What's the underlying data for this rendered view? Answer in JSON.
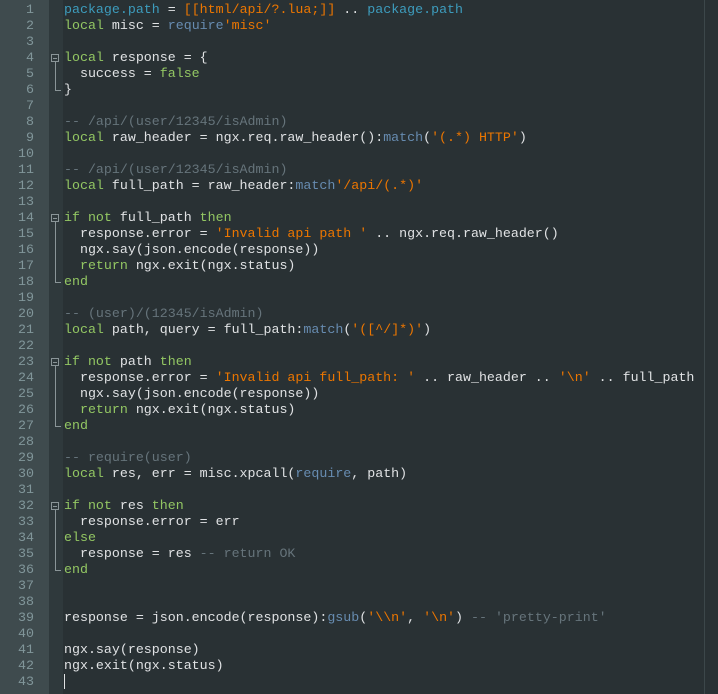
{
  "editor": {
    "language": "lua",
    "cursor_line": 43,
    "folds": [
      {
        "start": 4,
        "end": 6
      },
      {
        "start": 14,
        "end": 18
      },
      {
        "start": 23,
        "end": 27
      },
      {
        "start": 32,
        "end": 36
      }
    ],
    "colors": {
      "background": "#293134",
      "keyword": "#93c763",
      "string": "#ec7600",
      "function": "#678cb1",
      "library": "#3d9cbd",
      "comment": "#66747b",
      "identifier": "#e0e2e4",
      "line_number": "#81969a"
    },
    "lines": [
      [
        [
          "lib",
          "package.path"
        ],
        [
          "id",
          " = "
        ],
        [
          "str",
          "[[html/api/?.lua;]]"
        ],
        [
          "id",
          " .. "
        ],
        [
          "lib",
          "package.path"
        ]
      ],
      [
        [
          "kw",
          "local"
        ],
        [
          "id",
          " misc = "
        ],
        [
          "fn",
          "require"
        ],
        [
          "str",
          "'misc'"
        ]
      ],
      [],
      [
        [
          "kw",
          "local"
        ],
        [
          "id",
          " response = {"
        ]
      ],
      [
        [
          "id",
          "  success = "
        ],
        [
          "kw",
          "false"
        ]
      ],
      [
        [
          "id",
          "}"
        ]
      ],
      [],
      [
        [
          "cm",
          "-- /api/(user/12345/isAdmin)"
        ]
      ],
      [
        [
          "kw",
          "local"
        ],
        [
          "id",
          " raw_header = ngx.req.raw_header():"
        ],
        [
          "fn",
          "match"
        ],
        [
          "id",
          "("
        ],
        [
          "str",
          "'(.*) HTTP'"
        ],
        [
          "id",
          ")"
        ]
      ],
      [],
      [
        [
          "cm",
          "-- /api/(user/12345/isAdmin)"
        ]
      ],
      [
        [
          "kw",
          "local"
        ],
        [
          "id",
          " full_path = raw_header:"
        ],
        [
          "fn",
          "match"
        ],
        [
          "str",
          "'/api/(.*)'"
        ]
      ],
      [],
      [
        [
          "kw",
          "if not"
        ],
        [
          "id",
          " full_path "
        ],
        [
          "kw",
          "then"
        ]
      ],
      [
        [
          "id",
          "  response.error = "
        ],
        [
          "str",
          "'Invalid api path '"
        ],
        [
          "id",
          " .. ngx.req.raw_header()"
        ]
      ],
      [
        [
          "id",
          "  ngx.say(json.encode(response))"
        ]
      ],
      [
        [
          "kw",
          "  return"
        ],
        [
          "id",
          " ngx.exit(ngx.status)"
        ]
      ],
      [
        [
          "kw",
          "end"
        ]
      ],
      [],
      [
        [
          "cm",
          "-- (user)/(12345/isAdmin)"
        ]
      ],
      [
        [
          "kw",
          "local"
        ],
        [
          "id",
          " path, query = full_path:"
        ],
        [
          "fn",
          "match"
        ],
        [
          "id",
          "("
        ],
        [
          "str",
          "'([^/]*)'"
        ],
        [
          "id",
          ")"
        ]
      ],
      [],
      [
        [
          "kw",
          "if not"
        ],
        [
          "id",
          " path "
        ],
        [
          "kw",
          "then"
        ]
      ],
      [
        [
          "id",
          "  response.error = "
        ],
        [
          "str",
          "'Invalid api full_path: '"
        ],
        [
          "id",
          " .. raw_header .. "
        ],
        [
          "str",
          "'\\n'"
        ],
        [
          "id",
          " .. full_path"
        ]
      ],
      [
        [
          "id",
          "  ngx.say(json.encode(response))"
        ]
      ],
      [
        [
          "kw",
          "  return"
        ],
        [
          "id",
          " ngx.exit(ngx.status)"
        ]
      ],
      [
        [
          "kw",
          "end"
        ]
      ],
      [],
      [
        [
          "cm",
          "-- require(user)"
        ]
      ],
      [
        [
          "kw",
          "local"
        ],
        [
          "id",
          " res, err = misc.xpcall("
        ],
        [
          "fn",
          "require"
        ],
        [
          "id",
          ", path)"
        ]
      ],
      [],
      [
        [
          "kw",
          "if not"
        ],
        [
          "id",
          " res "
        ],
        [
          "kw",
          "then"
        ]
      ],
      [
        [
          "id",
          "  response.error = err"
        ]
      ],
      [
        [
          "kw",
          "else"
        ]
      ],
      [
        [
          "id",
          "  response = res "
        ],
        [
          "cm",
          "-- return OK"
        ]
      ],
      [
        [
          "kw",
          "end"
        ]
      ],
      [],
      [],
      [
        [
          "id",
          "response = json.encode(response):"
        ],
        [
          "fn",
          "gsub"
        ],
        [
          "id",
          "("
        ],
        [
          "str",
          "'\\\\n'"
        ],
        [
          "id",
          ", "
        ],
        [
          "str",
          "'\\n'"
        ],
        [
          "id",
          ") "
        ],
        [
          "cm",
          "-- 'pretty-print'"
        ]
      ],
      [],
      [
        [
          "id",
          "ngx.say(response)"
        ]
      ],
      [
        [
          "id",
          "ngx.exit(ngx.status)"
        ]
      ],
      []
    ]
  }
}
